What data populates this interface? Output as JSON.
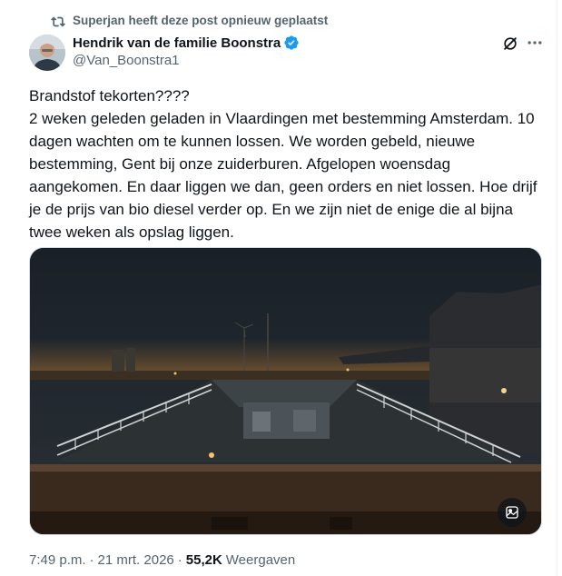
{
  "repost": {
    "label": "Superjan heeft deze post opnieuw geplaatst",
    "icon": "repost-icon"
  },
  "author": {
    "display_name": "Hendrik van de familie Boonstra",
    "handle": "@Van_Boonstra1",
    "verified": true,
    "verified_color": "#1d9bf0"
  },
  "post": {
    "text": "Brandstof tekorten????\n2 weken geleden geladen in Vlaardingen met bestemming Amsterdam. 10 dagen wachten om te kunnen lossen. We worden gebeld, nieuwe bestemming, Gent bij onze zuiderburen. Afgelopen woensdag aangekomen. En daar liggen we dan, geen orders en niet lossen. Hoe drijf je de prijs van bio diesel verder op. En we zijn niet de enige die al bijna twee weken als opslag liggen.",
    "media_description_icon": "image-alt-icon"
  },
  "meta": {
    "time": "7:49 p.m.",
    "separator": "·",
    "date": "21 mrt. 2026",
    "views_count": "55,2K",
    "views_label": "Weergaven"
  },
  "colors": {
    "text_primary": "#0f1419",
    "text_secondary": "#536471",
    "accent": "#1d9bf0",
    "border": "#cfd9de"
  }
}
